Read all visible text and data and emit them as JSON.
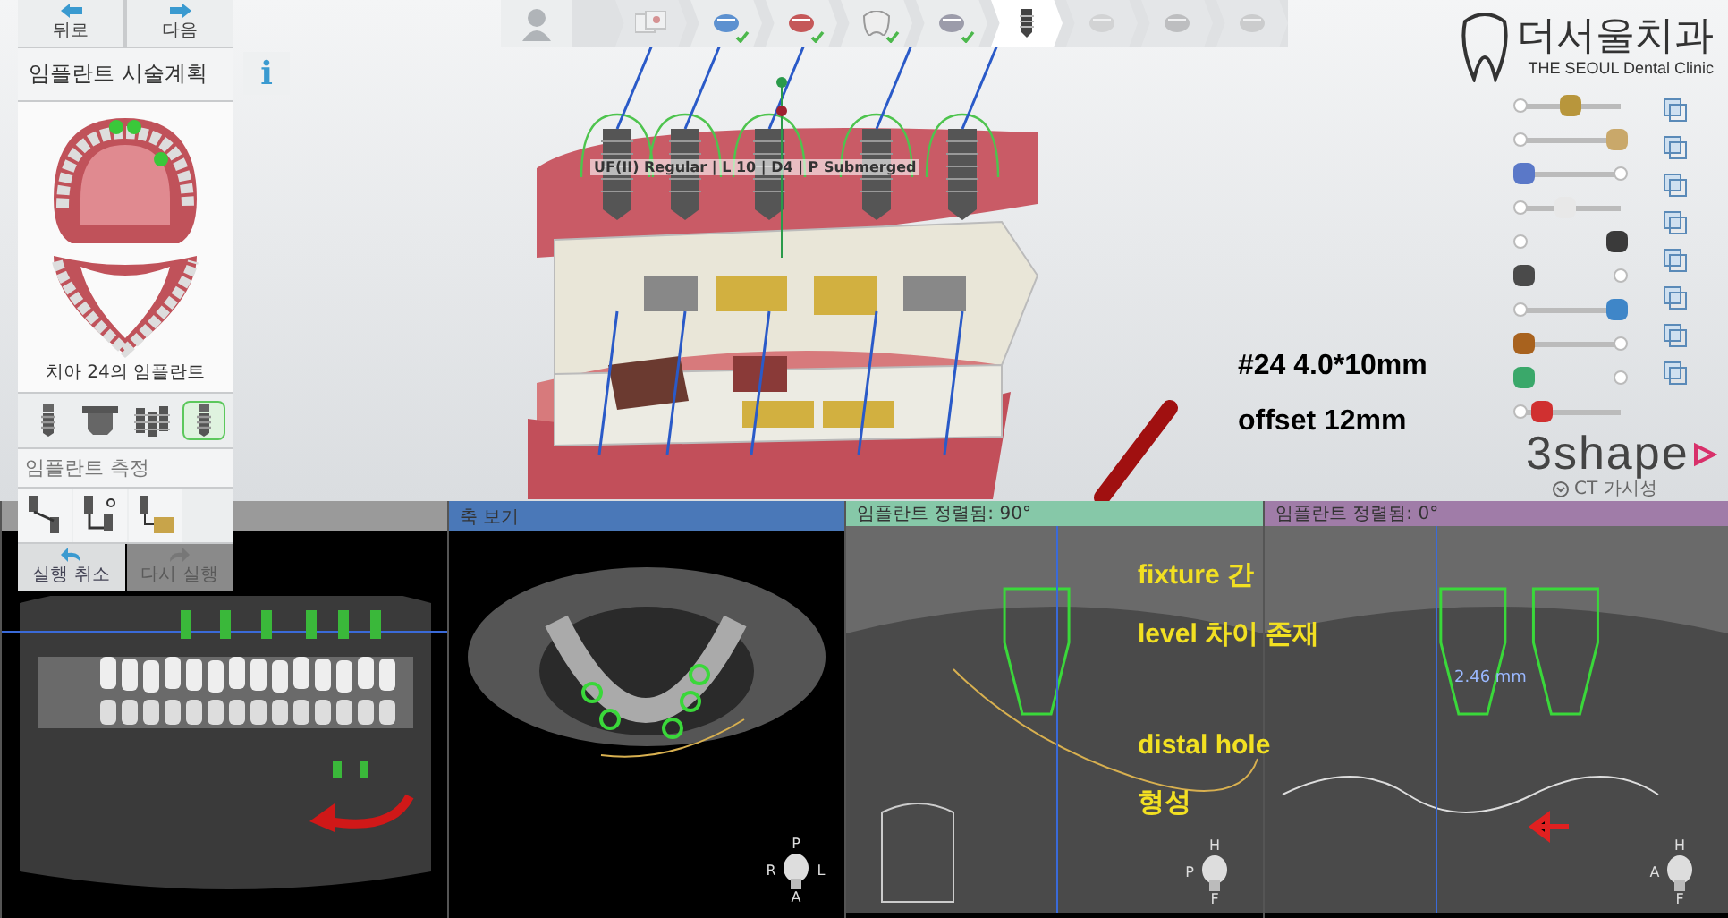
{
  "nav_buttons": [
    {
      "label": "뒤로",
      "kind": "back"
    },
    {
      "label": "다음",
      "kind": "next"
    }
  ],
  "planning_panel": {
    "title": "임플란트 시술계획",
    "info_label": "i",
    "caption": "치아 24의 임플란트",
    "tools": [
      {
        "kind": "single",
        "selected": false
      },
      {
        "kind": "abutment",
        "selected": false
      },
      {
        "kind": "multi",
        "selected": false
      },
      {
        "kind": "single",
        "selected": true
      }
    ],
    "measure_title": "임플란트 측정",
    "measure_tools": [
      {
        "kind": "distance"
      },
      {
        "kind": "angle"
      },
      {
        "kind": "bone"
      }
    ],
    "undo": {
      "label": "실행 취소",
      "disabled": false
    },
    "redo": {
      "label": "다시 실행",
      "disabled": true
    }
  },
  "workflow_steps": [
    {
      "kind": "documents",
      "completed": false,
      "selected": false
    },
    {
      "kind": "scan",
      "completed": true,
      "selected": false
    },
    {
      "kind": "tools",
      "completed": true,
      "selected": false
    },
    {
      "kind": "crown",
      "completed": true,
      "selected": false
    },
    {
      "kind": "jaw",
      "completed": true,
      "selected": false
    },
    {
      "kind": "implant",
      "completed": false,
      "selected": true
    },
    {
      "kind": "sleeve",
      "completed": false,
      "selected": false
    },
    {
      "kind": "guide",
      "completed": false,
      "selected": false
    },
    {
      "kind": "export",
      "completed": false,
      "selected": false
    }
  ],
  "clinic_logo": {
    "name": "더서울치과",
    "subtitle": "THE SEOUL Dental Clinic"
  },
  "visibility_sliders": [
    {
      "kind": "slider",
      "level": 0.5,
      "color": "#b8963c"
    },
    {
      "kind": "slider",
      "level": 1,
      "color": "#c9a86a"
    },
    {
      "kind": "slider",
      "level": 0,
      "color": "#5a78c8"
    },
    {
      "kind": "slider",
      "level": 0.45,
      "color": "#e8e8e8"
    },
    {
      "kind": "switch",
      "level": 1,
      "color": "#3a3a3a"
    },
    {
      "kind": "switch",
      "level": 0,
      "color": "#4a4a4a"
    },
    {
      "kind": "slider",
      "level": 1,
      "color": "#3f86c8"
    },
    {
      "kind": "slider",
      "level": 0,
      "color": "#a8621e"
    },
    {
      "kind": "switch",
      "level": 0,
      "color": "#3aa86a"
    },
    {
      "kind": "slider",
      "level": 0.2,
      "color": "#d03030"
    }
  ],
  "brand": "3shape",
  "ct_visibility": "CT 가시성",
  "implant_label": "UF(II) Regular | L 10 | D4 | P Submerged",
  "notes": [
    "#24 4.0*10mm",
    "offset 12mm"
  ],
  "ct_views": [
    {
      "kind": "panoramic",
      "color": "#9a9a9a"
    },
    {
      "kind": "axial",
      "title": "축 보기",
      "color": "#4a78b8",
      "orientation": {
        "top": "P",
        "left": "R",
        "right": "L",
        "bottom": "A"
      }
    },
    {
      "kind": "cross90",
      "title": "임플란트 정렬됨: 90°",
      "color": "#86c8a8",
      "annotations": [
        {
          "lines": [
            "fixture 간",
            "level 차이 존재"
          ]
        },
        {
          "lines": [
            "distal hole",
            "형성"
          ]
        }
      ],
      "orientation": {
        "top": "H",
        "left": "P",
        "bottom": "F"
      }
    },
    {
      "kind": "cross0",
      "title": "임플란트 정렬됨: 0°",
      "color": "#a07ca8",
      "measurement": "2.46 mm",
      "orientation": {
        "top": "H",
        "left": "A",
        "bottom": "F"
      }
    }
  ]
}
